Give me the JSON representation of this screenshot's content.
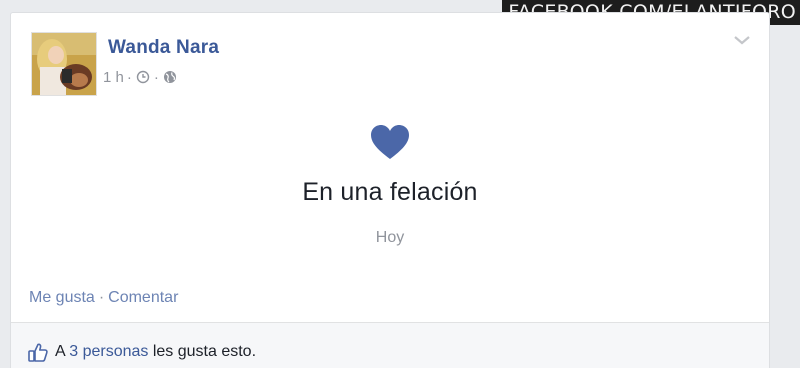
{
  "watermark": "FACEBOOK.COM/ELANTIFORO",
  "post": {
    "author": "Wanda Nara",
    "timestamp": "1 h",
    "meta_separator": "·",
    "icons": {
      "clock": "clock-icon",
      "audience": "globe-icon",
      "options": "chevron-down-icon",
      "event": "heart-icon",
      "like": "thumbs-up-icon"
    },
    "life_event": {
      "title": "En una felación",
      "date": "Hoy"
    },
    "actions": {
      "like": "Me gusta",
      "separator": "·",
      "comment": "Comentar"
    },
    "likes": {
      "prefix": "A ",
      "link": "3 personas",
      "suffix": " les gusta esto."
    }
  },
  "colors": {
    "brand_blue": "#3b5998",
    "heart": "#4b67a8",
    "meta_gray": "#90949c"
  }
}
